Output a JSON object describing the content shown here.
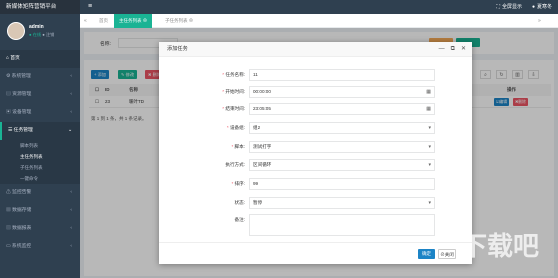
{
  "app": {
    "title": "新媒体矩阵营销平台",
    "menu_icon": "hamburger-icon"
  },
  "topbar": {
    "fullscreen_label": "全屏显示",
    "user_label": "夏寒冬"
  },
  "profile": {
    "name": "admin",
    "status": "● 在线",
    "logout": "● 注销"
  },
  "sidebar": {
    "home": "首页",
    "items": [
      {
        "label": "系统管理"
      },
      {
        "label": "资源管理"
      },
      {
        "label": "设备管理"
      },
      {
        "label": "任务管理"
      }
    ],
    "sub_items": [
      "脚本列表",
      "主任务列表",
      "子任务列表",
      "一键命令"
    ],
    "items_after": [
      {
        "label": "监控告警"
      },
      {
        "label": "数据存储"
      },
      {
        "label": "数据报表"
      },
      {
        "label": "系统监控"
      }
    ]
  },
  "tabs": {
    "home": "首页",
    "main_task": "主任务列表",
    "sub_task": "子任务列表"
  },
  "filter": {
    "name_label": "名称:"
  },
  "toolbar": {
    "add_label": "+ 添加",
    "edit_label": "✎ 修改",
    "delete_label": "✖ 删除"
  },
  "table": {
    "headers": [
      "ID",
      "名称",
      "操作"
    ],
    "rows": [
      {
        "id": "23",
        "name": "暖叶TD",
        "edit": "☑编辑",
        "delete": "✖删除"
      }
    ],
    "page_info": "第 1 到 1 条，共 1 条记录。"
  },
  "modal": {
    "title": "添加任务",
    "fields": [
      {
        "label": "任务名称:",
        "required": true,
        "value": "11",
        "kind": "text"
      },
      {
        "label": "开始时间:",
        "required": true,
        "value": "00:00:00",
        "kind": "date"
      },
      {
        "label": "结束时间:",
        "required": true,
        "value": "23:05:05",
        "kind": "date"
      },
      {
        "label": "设备组:",
        "required": true,
        "value": "组2",
        "kind": "select"
      },
      {
        "label": "脚本:",
        "required": true,
        "value": "测试打字",
        "kind": "select"
      },
      {
        "label": "执行方式:",
        "required": false,
        "value": "区间循环",
        "kind": "select"
      },
      {
        "label": "排序:",
        "required": true,
        "value": "99",
        "kind": "text"
      },
      {
        "label": "状态:",
        "required": false,
        "value": "暂停",
        "kind": "select"
      },
      {
        "label": "备注:",
        "required": false,
        "value": "",
        "kind": "textarea"
      }
    ],
    "ok_label": "确定",
    "cancel_label": "关闭"
  },
  "watermark": "下载吧"
}
